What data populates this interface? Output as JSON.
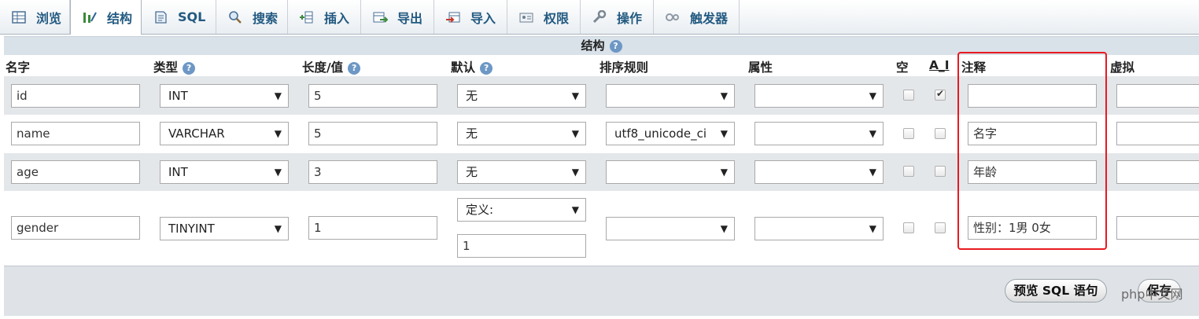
{
  "tabs": [
    {
      "label": "浏览",
      "icon": "browse-table-icon",
      "active": false
    },
    {
      "label": "结构",
      "icon": "structure-icon",
      "active": true
    },
    {
      "label": "SQL",
      "icon": "sql-icon",
      "active": false
    },
    {
      "label": "搜索",
      "icon": "search-icon",
      "active": false
    },
    {
      "label": "插入",
      "icon": "insert-icon",
      "active": false
    },
    {
      "label": "导出",
      "icon": "export-icon",
      "active": false
    },
    {
      "label": "导入",
      "icon": "import-icon",
      "active": false
    },
    {
      "label": "权限",
      "icon": "privileges-icon",
      "active": false
    },
    {
      "label": "操作",
      "icon": "wrench-icon",
      "active": false
    },
    {
      "label": "触发器",
      "icon": "triggers-icon",
      "active": false
    }
  ],
  "section": {
    "title": "结构",
    "help": "?"
  },
  "columns": {
    "name": "名字",
    "type": "类型",
    "length": "长度/值",
    "default": "默认",
    "collation": "排序规则",
    "attributes": "属性",
    "null": "空",
    "ai": "A_I",
    "comment": "注释",
    "virtual": "虚拟"
  },
  "fields": [
    {
      "name": "id",
      "type": "INT",
      "length": "5",
      "default": "无",
      "collation": "",
      "attributes": "",
      "null": false,
      "ai": true,
      "comment": ""
    },
    {
      "name": "name",
      "type": "VARCHAR",
      "length": "5",
      "default": "无",
      "collation": "utf8_unicode_ci",
      "attributes": "",
      "null": false,
      "ai": false,
      "comment": "名字"
    },
    {
      "name": "age",
      "type": "INT",
      "length": "3",
      "default": "无",
      "collation": "",
      "attributes": "",
      "null": false,
      "ai": false,
      "comment": "年龄"
    },
    {
      "name": "gender",
      "type": "TINYINT",
      "length": "1",
      "default": "定义:",
      "default_value": "1",
      "collation": "",
      "attributes": "",
      "null": false,
      "ai": false,
      "comment": "性别：1男 0女"
    }
  ],
  "footer": {
    "preview_sql": "预览 SQL 语句",
    "save": "保存"
  },
  "watermark": "php中文网",
  "highlight_color": "#e8191f"
}
